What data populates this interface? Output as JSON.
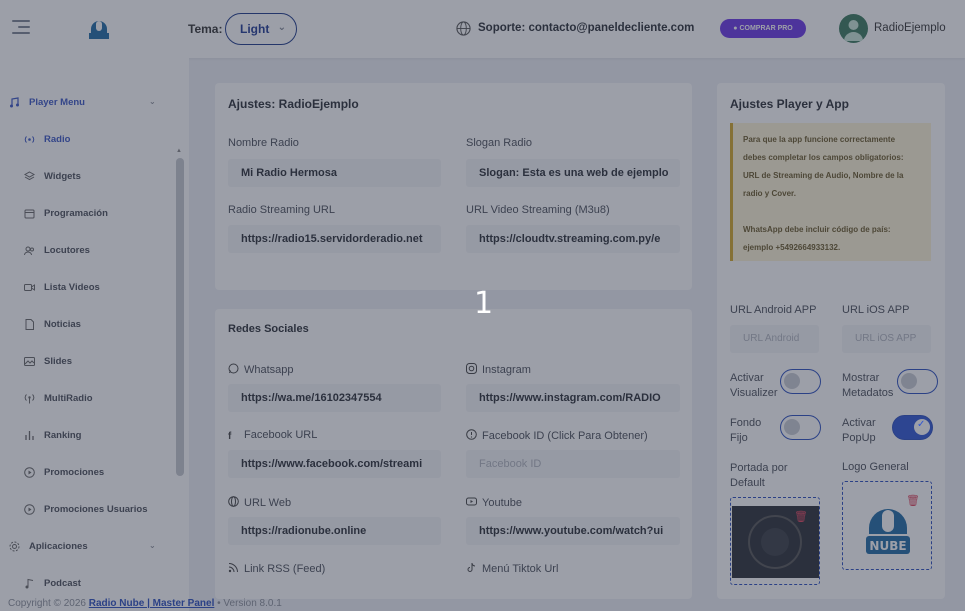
{
  "header": {
    "tema_label": "Tema:",
    "tema_value": "Light",
    "support_text": "Soporte: contacto@paneldecliente.com",
    "buy_label": "COMPRAR PRO",
    "user_name": "RadioEjemplo"
  },
  "sidebar": {
    "player_menu": "Player Menu",
    "items": [
      "Radio",
      "Widgets",
      "Programación",
      "Locutores",
      "Lista Videos",
      "Noticias",
      "Slides",
      "MultiRadio",
      "Ranking",
      "Promociones",
      "Promociones Usuarios"
    ],
    "apps_section": "Aplicaciones",
    "apps_items": [
      "Podcast"
    ]
  },
  "ajustes": {
    "title": "Ajustes: RadioEjemplo",
    "nombre_label": "Nombre Radio",
    "nombre_value": "Mi Radio Hermosa",
    "slogan_label": "Slogan Radio",
    "slogan_value": "Slogan: Esta es una web de ejemplo",
    "stream_label": "Radio Streaming URL",
    "stream_value": "https://radio15.servidorderadio.net",
    "video_label": "URL Video Streaming (M3u8)",
    "video_value": "https://cloudtv.streaming.com.py/e"
  },
  "redes": {
    "title": "Redes Sociales",
    "whatsapp_label": "Whatsapp",
    "whatsapp_value": "https://wa.me/16102347554",
    "instagram_label": "Instagram",
    "instagram_value": "https://www.instagram.com/RADIO",
    "facebook_label": "Facebook URL",
    "facebook_value": "https://www.facebook.com/streami",
    "fbid_label": "Facebook ID (Click Para Obtener)",
    "fbid_placeholder": "Facebook ID",
    "web_label": "URL Web",
    "web_value": "https://radionube.online",
    "youtube_label": "Youtube",
    "youtube_value": "https://www.youtube.com/watch?ui",
    "rss_label": "Link RSS (Feed)",
    "tiktok_label": "Menú Tiktok Url"
  },
  "player": {
    "title": "Ajustes Player y App",
    "note_lines": [
      "Para que la app funcione correctamente",
      "debes completar los campos obligatorios:",
      "URL de Streaming de Audio, Nombre de la",
      "radio y Cover.",
      "",
      "WhatsApp debe incluir código de país:",
      "ejemplo +5492664933132."
    ],
    "android_label": "URL Android APP",
    "android_placeholder": "URL Android",
    "ios_label": "URL iOS APP",
    "ios_placeholder": "URL iOS APP",
    "visualizer_label_1": "Activar",
    "visualizer_label_2": "Visualizer",
    "visualizer_on": false,
    "metadatos_label_1": "Mostrar",
    "metadatos_label_2": "Metadatos",
    "metadatos_on": false,
    "fondo_label_1": "Fondo",
    "fondo_label_2": "Fijo",
    "fondo_on": false,
    "popup_label_1": "Activar",
    "popup_label_2": "PopUp",
    "popup_on": true,
    "portada_label_1": "Portada por",
    "portada_label_2": "Default",
    "logo_label": "Logo General",
    "logo_text": "NUBE"
  },
  "footer": {
    "copyright": "Copyright © 2026",
    "link": "Radio Nube | Master Panel",
    "version": "•  Version 8.0.1"
  },
  "overlay": {
    "step": "1"
  },
  "colors": {
    "accent": "#2f56d4",
    "buy": "#6a35e6",
    "note_bg": "#fdf4d6",
    "overlay": "rgba(45,52,70,0.47)"
  }
}
